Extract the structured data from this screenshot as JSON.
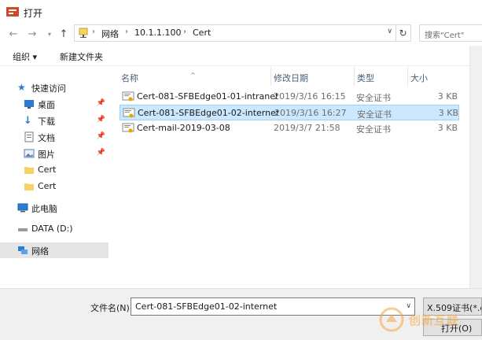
{
  "window": {
    "title": "打开"
  },
  "address": {
    "crumbs": [
      "网络",
      "10.1.1.100",
      "Cert"
    ],
    "separator": "›"
  },
  "search": {
    "placeholder": "搜索\"Cert\""
  },
  "toolbar": {
    "organize": "组织 ▾",
    "new_folder": "新建文件夹"
  },
  "nav": {
    "quick_access": "快速访问",
    "desktop": "桌面",
    "downloads": "下载",
    "documents": "文档",
    "pictures": "图片",
    "cert1": "Cert",
    "cert2": "Cert",
    "this_pc": "此电脑",
    "data_drive": "DATA (D:)",
    "network": "网络"
  },
  "columns": {
    "name": "名称",
    "modified": "修改日期",
    "type": "类型",
    "size": "大小"
  },
  "files": [
    {
      "name": "Cert-081-SFBEdge01-01-intranet",
      "modified": "2019/3/16 16:15",
      "type": "安全证书",
      "size": "3 KB"
    },
    {
      "name": "Cert-081-SFBEdge01-02-internet",
      "modified": "2019/3/16 16:27",
      "type": "安全证书",
      "size": "3 KB"
    },
    {
      "name": "Cert-mail-2019-03-08",
      "modified": "2019/3/7 21:58",
      "type": "安全证书",
      "size": "3 KB"
    }
  ],
  "bottom": {
    "filename_label": "文件名(N):",
    "filename_value": "Cert-081-SFBEdge01-02-internet",
    "filter_value": "X.509证书(*.cer",
    "open_label": "打开(O)"
  },
  "watermark": {
    "text": "创新互联"
  }
}
